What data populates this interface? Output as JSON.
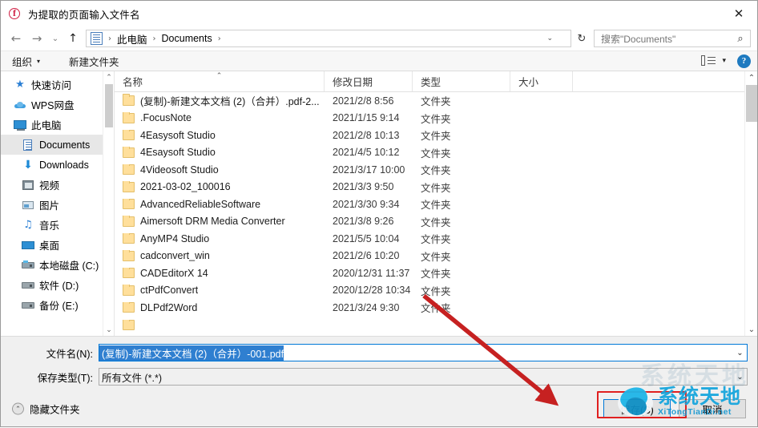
{
  "window": {
    "title": "为提取的页面输入文件名",
    "app_icon": "foxit-pdf-icon",
    "close_label": "✕"
  },
  "navigation": {
    "back_label": "←",
    "forward_label": "→",
    "history_label": "⌄",
    "up_label": "↑",
    "refresh_label": "↻",
    "breadcrumb": {
      "icon": "documents-folder-icon",
      "items": [
        "此电脑",
        "Documents"
      ],
      "separator": "›",
      "dropdown_caret": "⌄"
    }
  },
  "search": {
    "placeholder": "搜索\"Documents\"",
    "icon": "search-icon"
  },
  "command_bar": {
    "organize_label": "组织",
    "organize_caret": "▾",
    "new_folder_label": "新建文件夹",
    "view_caret": "▾",
    "help_label": "?"
  },
  "sidebar": {
    "items": [
      {
        "label": "快速访问",
        "icon": "star-icon",
        "indent": false,
        "selected": false
      },
      {
        "label": "WPS网盘",
        "icon": "cloud-icon",
        "indent": false,
        "selected": false
      },
      {
        "label": "此电脑",
        "icon": "computer-icon",
        "indent": false,
        "selected": false
      },
      {
        "label": "Documents",
        "icon": "documents-icon",
        "indent": true,
        "selected": true
      },
      {
        "label": "Downloads",
        "icon": "downloads-icon",
        "indent": true,
        "selected": false
      },
      {
        "label": "视频",
        "icon": "video-icon",
        "indent": true,
        "selected": false
      },
      {
        "label": "图片",
        "icon": "pictures-icon",
        "indent": true,
        "selected": false
      },
      {
        "label": "音乐",
        "icon": "music-icon",
        "indent": true,
        "selected": false
      },
      {
        "label": "桌面",
        "icon": "desktop-icon",
        "indent": true,
        "selected": false
      },
      {
        "label": "本地磁盘 (C:)",
        "icon": "system-drive-icon",
        "indent": true,
        "selected": false
      },
      {
        "label": "软件 (D:)",
        "icon": "drive-icon",
        "indent": true,
        "selected": false
      },
      {
        "label": "备份 (E:)",
        "icon": "drive-icon",
        "indent": true,
        "selected": false
      }
    ],
    "scroll_up": "⌃",
    "scroll_down": "⌄"
  },
  "file_list": {
    "columns": {
      "name": "名称",
      "date": "修改日期",
      "type": "类型",
      "size": "大小",
      "sort_indicator": "⌃"
    },
    "rows": [
      {
        "name": "(复制)-新建文本文档 (2)（合并）.pdf-2...",
        "date": "2021/2/8 8:56",
        "type": "文件夹",
        "size": ""
      },
      {
        "name": ".FocusNote",
        "date": "2021/1/15 9:14",
        "type": "文件夹",
        "size": ""
      },
      {
        "name": "4Easysoft Studio",
        "date": "2021/2/8 10:13",
        "type": "文件夹",
        "size": ""
      },
      {
        "name": "4Esaysoft Studio",
        "date": "2021/4/5 10:12",
        "type": "文件夹",
        "size": ""
      },
      {
        "name": "4Videosoft Studio",
        "date": "2021/3/17 10:00",
        "type": "文件夹",
        "size": ""
      },
      {
        "name": "2021-03-02_100016",
        "date": "2021/3/3 9:50",
        "type": "文件夹",
        "size": ""
      },
      {
        "name": "AdvancedReliableSoftware",
        "date": "2021/3/30 9:34",
        "type": "文件夹",
        "size": ""
      },
      {
        "name": "Aimersoft DRM Media Converter",
        "date": "2021/3/8 9:26",
        "type": "文件夹",
        "size": ""
      },
      {
        "name": "AnyMP4 Studio",
        "date": "2021/5/5 10:04",
        "type": "文件夹",
        "size": ""
      },
      {
        "name": "cadconvert_win",
        "date": "2021/2/6 10:20",
        "type": "文件夹",
        "size": ""
      },
      {
        "name": "CADEditorX 14",
        "date": "2020/12/31 11:37",
        "type": "文件夹",
        "size": ""
      },
      {
        "name": "ctPdfConvert",
        "date": "2020/12/28 10:34",
        "type": "文件夹",
        "size": ""
      },
      {
        "name": "DLPdf2Word",
        "date": "2021/3/24 9:30",
        "type": "文件夹",
        "size": ""
      }
    ],
    "scroll_up": "⌃",
    "scroll_down": "⌄"
  },
  "form": {
    "filename_label": "文件名(N):",
    "filename_value": "(复制)-新建文本文档 (2)（合并）-001.pdf",
    "filename_caret": "⌄",
    "filetype_label": "保存类型(T):",
    "filetype_value": "所有文件 (*.*)",
    "filetype_caret": "⌄"
  },
  "footer": {
    "hide_folders_label": "隐藏文件夹",
    "hide_folders_caret": "⌃",
    "save_button": "保存(S)",
    "cancel_button": "取消"
  },
  "watermark": {
    "cn": "系统天地",
    "en": "XiTongTianDi.net",
    "ghost": "系统天地"
  },
  "annotations": {
    "accent_red": "#e02020",
    "selection_blue": "#2f7fd0",
    "focus_blue": "#0078d7"
  }
}
